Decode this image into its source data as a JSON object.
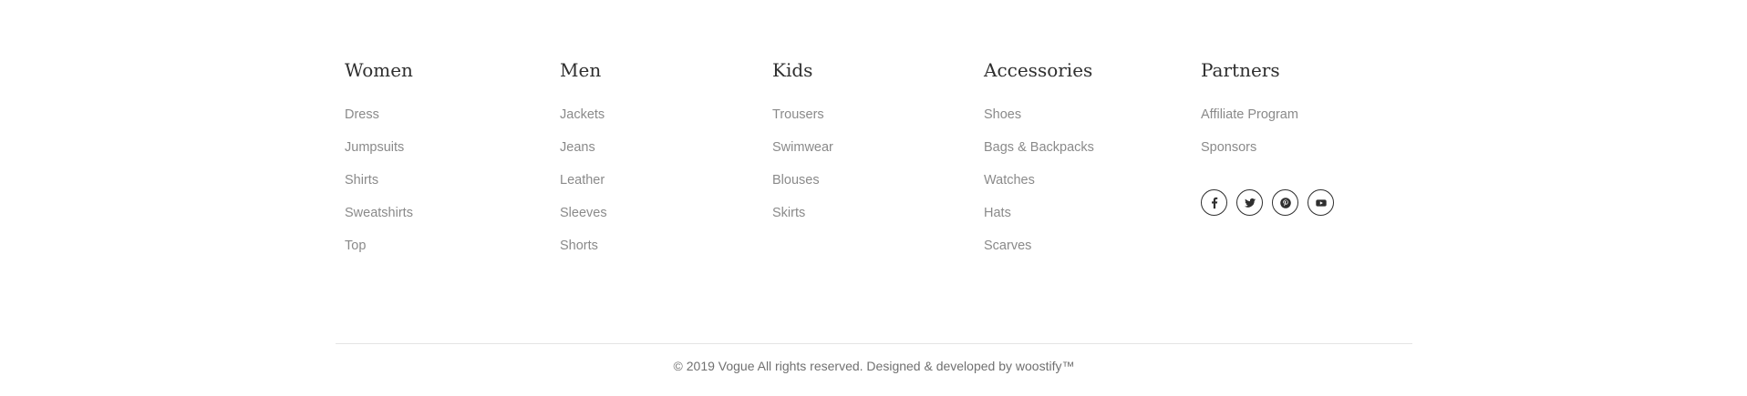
{
  "footer": {
    "columns": [
      {
        "title": "Women",
        "links": [
          "Dress",
          "Jumpsuits",
          "Shirts",
          "Sweatshirts",
          "Top"
        ]
      },
      {
        "title": "Men",
        "links": [
          "Jackets",
          "Jeans",
          "Leather",
          "Sleeves",
          "Shorts"
        ]
      },
      {
        "title": "Kids",
        "links": [
          "Trousers",
          "Swimwear",
          "Blouses",
          "Skirts"
        ]
      },
      {
        "title": "Accessories",
        "links": [
          "Shoes",
          "Bags & Backpacks",
          "Watches",
          "Hats",
          "Scarves"
        ]
      },
      {
        "title": "Partners",
        "links": [
          "Affiliate Program",
          "Sponsors"
        ]
      }
    ],
    "social": [
      "facebook-icon",
      "twitter-icon",
      "pinterest-icon",
      "youtube-icon"
    ],
    "copyright": "© 2019 Vogue All rights reserved. Designed & developed by woostify™"
  },
  "colors": {
    "heading": "#2f2f2f",
    "link": "#8a8a8a",
    "copyright": "#707070",
    "divider": "#e4e4e4"
  }
}
